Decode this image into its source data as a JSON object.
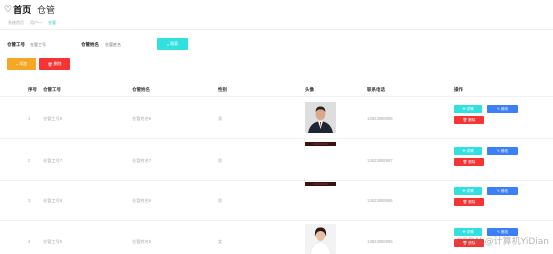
{
  "header": {
    "home_label": "首页",
    "current_label": "仓管",
    "breadcrumbs": [
      "系统首页",
      "用户一",
      "仓管"
    ]
  },
  "search": {
    "field1_label": "仓管工号",
    "field1_placeholder": "仓管工号",
    "field2_label": "仓管姓名",
    "field2_placeholder": "仓管姓名",
    "search_button": "搜索"
  },
  "actions": {
    "add_button": "添加",
    "delete_button": "删除"
  },
  "table": {
    "headers": [
      "序号",
      "仓管工号",
      "仓管姓名",
      "性别",
      "头像",
      "联系电话",
      "操作"
    ],
    "rows": [
      {
        "index": "1",
        "id": "仓管工号8",
        "name": "仓管姓名8",
        "gender": "男",
        "phone": "13823888988",
        "avatar": "man-suit"
      },
      {
        "index": "2",
        "id": "仓管工号7",
        "name": "仓管姓名7",
        "gender": "男",
        "phone": "13823888987",
        "avatar": "dark-photo"
      },
      {
        "index": "3",
        "id": "仓管工号6",
        "name": "仓管姓名6",
        "gender": "男",
        "phone": "13823888986",
        "avatar": "dark-photo"
      },
      {
        "index": "4",
        "id": "仓管工号5",
        "name": "仓管姓名5",
        "gender": "女",
        "phone": "13823888985",
        "avatar": "woman-white"
      }
    ],
    "op_detail": "详情",
    "op_edit": "修改",
    "op_delete": "删除"
  },
  "watermark": "CSDN @计算机YiDian",
  "colors": {
    "cyan": "#33e0e0",
    "orange": "#f5a623",
    "red": "#f53535",
    "blue": "#3d7ff5"
  }
}
